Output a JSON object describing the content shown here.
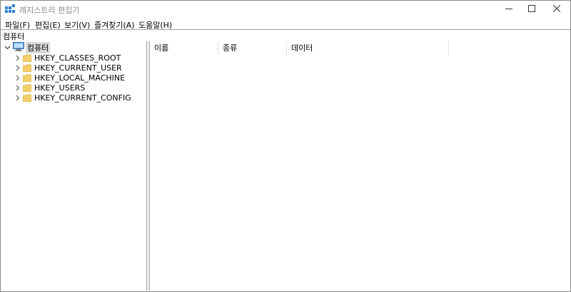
{
  "window": {
    "title": "레지스트리 편집기"
  },
  "icons": {
    "app": "registry-editor-icon",
    "minimize": "minimize-icon",
    "maximize": "maximize-icon",
    "close": "close-icon",
    "computer": "computer-icon",
    "folder": "folder-icon",
    "expand": "chevron-right-icon",
    "collapse": "chevron-down-icon"
  },
  "menu": {
    "file": "파일(F)",
    "edit": "편집(E)",
    "view": "보기(V)",
    "favorites": "즐겨찾기(A)",
    "help": "도움말(H)"
  },
  "address": {
    "path": "컴퓨터"
  },
  "tree": {
    "root_label": "컴퓨터",
    "keys": [
      {
        "label": "HKEY_CLASSES_ROOT"
      },
      {
        "label": "HKEY_CURRENT_USER"
      },
      {
        "label": "HKEY_LOCAL_MACHINE"
      },
      {
        "label": "HKEY_USERS"
      },
      {
        "label": "HKEY_CURRENT_CONFIG"
      }
    ]
  },
  "list": {
    "columns": [
      "이름",
      "종류",
      "데이터"
    ]
  },
  "colors": {
    "folder": "#f2cf6b",
    "selection": "#d9d9d9",
    "border": "#a0a0a0"
  }
}
